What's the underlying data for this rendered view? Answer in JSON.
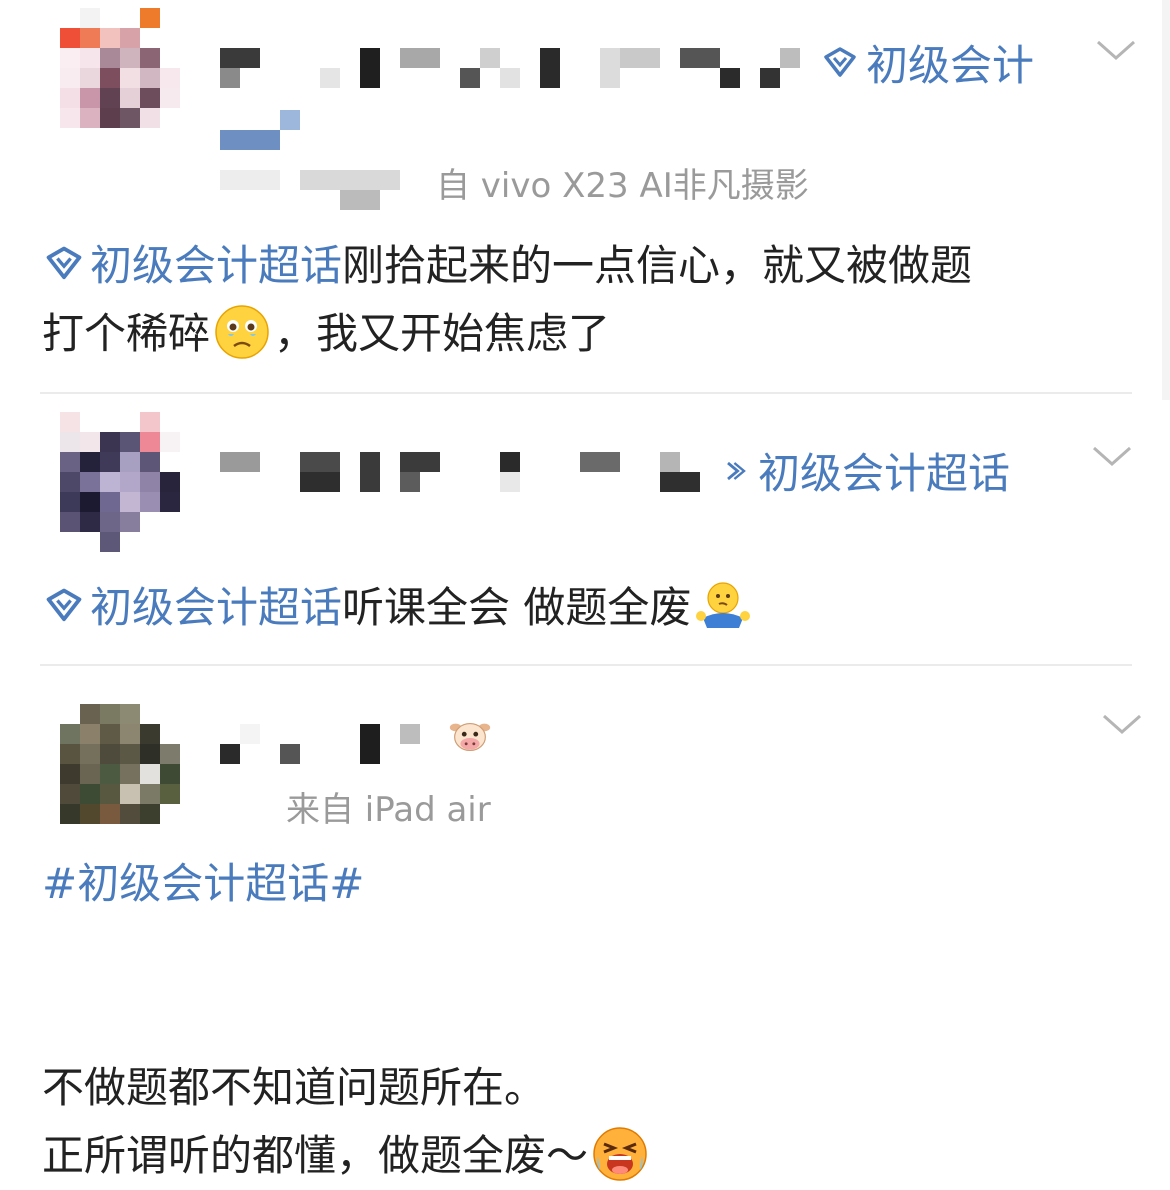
{
  "posts": [
    {
      "topic_tag": "初级会计",
      "source": "自 vivo X23 AI非凡摄影",
      "content": {
        "link": "初级会计超话",
        "text1": "刚拾起来的一点信心，就又被做题",
        "text2": "打个稀碎",
        "emoji1": "sad-tears-emoji",
        "text3": "，我又开始焦虑了"
      }
    },
    {
      "topic_tag": "初级会计超话",
      "content": {
        "link": "初级会计超话",
        "text1": "听课全会 做题全废",
        "emoji1": "shrug-emoji"
      }
    },
    {
      "badge_icon": "cow-face-emoji",
      "source": "来自 iPad air",
      "content": {
        "hashtag": "#初级会计超话#",
        "line1": "不做题都不知道问题所在。",
        "line2": "正所谓听的都懂，做题全废～",
        "emoji1": "crying-loud-emoji"
      }
    }
  ],
  "colors": {
    "link": "#4a7bbd",
    "text": "#222222",
    "muted": "#9a9a9a",
    "divider": "#ebebeb"
  }
}
